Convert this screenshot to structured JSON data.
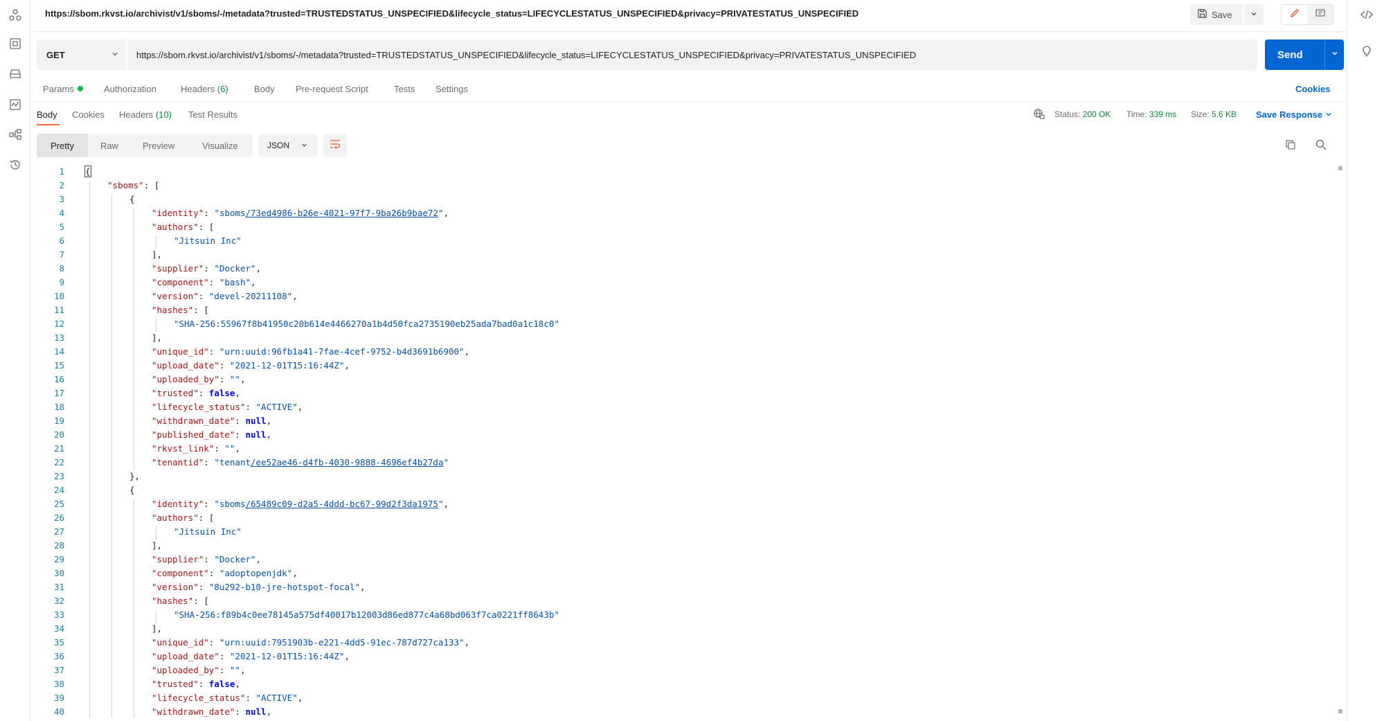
{
  "title_url": "https://sbom.rkvst.io/archivist/v1/sboms/-/metadata?trusted=TRUSTEDSTATUS_UNSPECIFIED&lifecycle_status=LIFECYCLESTATUS_UNSPECIFIED&privacy=PRIVATESTATUS_UNSPECIFIED",
  "save_label": "Save",
  "request": {
    "method": "GET",
    "url": "https://sbom.rkvst.io/archivist/v1/sboms/-/metadata?trusted=TRUSTEDSTATUS_UNSPECIFIED&lifecycle_status=LIFECYCLESTATUS_UNSPECIFIED&privacy=PRIVATESTATUS_UNSPECIFIED",
    "send_label": "Send"
  },
  "request_tabs": {
    "params": "Params",
    "authorization": "Authorization",
    "headers": "Headers",
    "headers_count": "(6)",
    "body": "Body",
    "prerequest": "Pre-request Script",
    "tests": "Tests",
    "settings": "Settings",
    "cookies": "Cookies"
  },
  "response_tabs": {
    "body": "Body",
    "cookies": "Cookies",
    "headers": "Headers",
    "headers_count": "(10)",
    "test_results": "Test Results"
  },
  "response_status": {
    "status_label": "Status:",
    "status_value": "200 OK",
    "time_label": "Time:",
    "time_value": "339 ms",
    "size_label": "Size:",
    "size_value": "5.6 KB",
    "save_response": "Save Response"
  },
  "view_modes": {
    "pretty": "Pretty",
    "raw": "Raw",
    "preview": "Preview",
    "visualize": "Visualize",
    "format": "JSON"
  },
  "icons": {
    "left_rail": [
      "collections-icon",
      "environments-icon",
      "mock-servers-icon",
      "monitors-icon",
      "flows-icon",
      "history-icon"
    ],
    "right_rail": [
      "code-icon",
      "lightbulb-icon"
    ],
    "toolbar": [
      "save-icon",
      "chevron-down-icon",
      "edit-icon",
      "comment-icon",
      "wrap-lines-icon",
      "copy-icon",
      "search-icon",
      "globe-icon"
    ]
  },
  "colors": {
    "send": "#0265d2",
    "status_ok": "#0d8a3a",
    "tab_underline": "#ff6c37",
    "json_key": "#a31515",
    "json_string": "#0451a5",
    "json_literal": "#0000ff",
    "line_number": "#1a7fa3"
  },
  "code_lines": [
    {
      "n": "1",
      "indent": 0,
      "tokens": [
        {
          "t": "p",
          "v": "{"
        }
      ]
    },
    {
      "n": "2",
      "indent": 1,
      "tokens": [
        {
          "t": "k",
          "v": "\"sboms\""
        },
        {
          "t": "p",
          "v": ": ["
        }
      ]
    },
    {
      "n": "3",
      "indent": 2,
      "tokens": [
        {
          "t": "p",
          "v": "{"
        }
      ]
    },
    {
      "n": "4",
      "indent": 3,
      "tokens": [
        {
          "t": "k",
          "v": "\"identity\""
        },
        {
          "t": "p",
          "v": ": "
        },
        {
          "t": "s",
          "v": "\"sboms"
        },
        {
          "t": "lk",
          "v": "/73ed4986-b26e-4021-97f7-9ba26b9bae72"
        },
        {
          "t": "s",
          "v": "\""
        },
        {
          "t": "p",
          "v": ","
        }
      ]
    },
    {
      "n": "5",
      "indent": 3,
      "tokens": [
        {
          "t": "k",
          "v": "\"authors\""
        },
        {
          "t": "p",
          "v": ": ["
        }
      ]
    },
    {
      "n": "6",
      "indent": 4,
      "tokens": [
        {
          "t": "s",
          "v": "\"Jitsuin Inc\""
        }
      ]
    },
    {
      "n": "7",
      "indent": 3,
      "tokens": [
        {
          "t": "p",
          "v": "],"
        }
      ]
    },
    {
      "n": "8",
      "indent": 3,
      "tokens": [
        {
          "t": "k",
          "v": "\"supplier\""
        },
        {
          "t": "p",
          "v": ": "
        },
        {
          "t": "s",
          "v": "\"Docker\""
        },
        {
          "t": "p",
          "v": ","
        }
      ]
    },
    {
      "n": "9",
      "indent": 3,
      "tokens": [
        {
          "t": "k",
          "v": "\"component\""
        },
        {
          "t": "p",
          "v": ": "
        },
        {
          "t": "s",
          "v": "\"bash\""
        },
        {
          "t": "p",
          "v": ","
        }
      ]
    },
    {
      "n": "10",
      "indent": 3,
      "tokens": [
        {
          "t": "k",
          "v": "\"version\""
        },
        {
          "t": "p",
          "v": ": "
        },
        {
          "t": "s",
          "v": "\"devel-20211108\""
        },
        {
          "t": "p",
          "v": ","
        }
      ]
    },
    {
      "n": "11",
      "indent": 3,
      "tokens": [
        {
          "t": "k",
          "v": "\"hashes\""
        },
        {
          "t": "p",
          "v": ": ["
        }
      ]
    },
    {
      "n": "12",
      "indent": 4,
      "tokens": [
        {
          "t": "s",
          "v": "\"SHA-256:55967f8b41950c20b614e4466270a1b4d50fca2735190eb25ada7bad0a1c18c0\""
        }
      ]
    },
    {
      "n": "13",
      "indent": 3,
      "tokens": [
        {
          "t": "p",
          "v": "],"
        }
      ]
    },
    {
      "n": "14",
      "indent": 3,
      "tokens": [
        {
          "t": "k",
          "v": "\"unique_id\""
        },
        {
          "t": "p",
          "v": ": "
        },
        {
          "t": "s",
          "v": "\"urn:uuid:96fb1a41-7fae-4cef-9752-b4d3691b6900\""
        },
        {
          "t": "p",
          "v": ","
        }
      ]
    },
    {
      "n": "15",
      "indent": 3,
      "tokens": [
        {
          "t": "k",
          "v": "\"upload_date\""
        },
        {
          "t": "p",
          "v": ": "
        },
        {
          "t": "s",
          "v": "\"2021-12-01T15:16:44Z\""
        },
        {
          "t": "p",
          "v": ","
        }
      ]
    },
    {
      "n": "16",
      "indent": 3,
      "tokens": [
        {
          "t": "k",
          "v": "\"uploaded_by\""
        },
        {
          "t": "p",
          "v": ": "
        },
        {
          "t": "s",
          "v": "\"\""
        },
        {
          "t": "p",
          "v": ","
        }
      ]
    },
    {
      "n": "17",
      "indent": 3,
      "tokens": [
        {
          "t": "k",
          "v": "\"trusted\""
        },
        {
          "t": "p",
          "v": ": "
        },
        {
          "t": "b",
          "v": "false"
        },
        {
          "t": "p",
          "v": ","
        }
      ]
    },
    {
      "n": "18",
      "indent": 3,
      "tokens": [
        {
          "t": "k",
          "v": "\"lifecycle_status\""
        },
        {
          "t": "p",
          "v": ": "
        },
        {
          "t": "s",
          "v": "\"ACTIVE\""
        },
        {
          "t": "p",
          "v": ","
        }
      ]
    },
    {
      "n": "19",
      "indent": 3,
      "tokens": [
        {
          "t": "k",
          "v": "\"withdrawn_date\""
        },
        {
          "t": "p",
          "v": ": "
        },
        {
          "t": "b",
          "v": "null"
        },
        {
          "t": "p",
          "v": ","
        }
      ]
    },
    {
      "n": "20",
      "indent": 3,
      "tokens": [
        {
          "t": "k",
          "v": "\"published_date\""
        },
        {
          "t": "p",
          "v": ": "
        },
        {
          "t": "b",
          "v": "null"
        },
        {
          "t": "p",
          "v": ","
        }
      ]
    },
    {
      "n": "21",
      "indent": 3,
      "tokens": [
        {
          "t": "k",
          "v": "\"rkvst_link\""
        },
        {
          "t": "p",
          "v": ": "
        },
        {
          "t": "s",
          "v": "\"\""
        },
        {
          "t": "p",
          "v": ","
        }
      ]
    },
    {
      "n": "22",
      "indent": 3,
      "tokens": [
        {
          "t": "k",
          "v": "\"tenantid\""
        },
        {
          "t": "p",
          "v": ": "
        },
        {
          "t": "s",
          "v": "\"tenant"
        },
        {
          "t": "lk",
          "v": "/ee52ae46-d4fb-4030-9888-4696ef4b27da"
        },
        {
          "t": "s",
          "v": "\""
        }
      ]
    },
    {
      "n": "23",
      "indent": 2,
      "tokens": [
        {
          "t": "p",
          "v": "},"
        }
      ]
    },
    {
      "n": "24",
      "indent": 2,
      "tokens": [
        {
          "t": "p",
          "v": "{"
        }
      ]
    },
    {
      "n": "25",
      "indent": 3,
      "tokens": [
        {
          "t": "k",
          "v": "\"identity\""
        },
        {
          "t": "p",
          "v": ": "
        },
        {
          "t": "s",
          "v": "\"sboms"
        },
        {
          "t": "lk",
          "v": "/65489c09-d2a5-4ddd-bc67-99d2f3da1975"
        },
        {
          "t": "s",
          "v": "\""
        },
        {
          "t": "p",
          "v": ","
        }
      ]
    },
    {
      "n": "26",
      "indent": 3,
      "tokens": [
        {
          "t": "k",
          "v": "\"authors\""
        },
        {
          "t": "p",
          "v": ": ["
        }
      ]
    },
    {
      "n": "27",
      "indent": 4,
      "tokens": [
        {
          "t": "s",
          "v": "\"Jitsuin Inc\""
        }
      ]
    },
    {
      "n": "28",
      "indent": 3,
      "tokens": [
        {
          "t": "p",
          "v": "],"
        }
      ]
    },
    {
      "n": "29",
      "indent": 3,
      "tokens": [
        {
          "t": "k",
          "v": "\"supplier\""
        },
        {
          "t": "p",
          "v": ": "
        },
        {
          "t": "s",
          "v": "\"Docker\""
        },
        {
          "t": "p",
          "v": ","
        }
      ]
    },
    {
      "n": "30",
      "indent": 3,
      "tokens": [
        {
          "t": "k",
          "v": "\"component\""
        },
        {
          "t": "p",
          "v": ": "
        },
        {
          "t": "s",
          "v": "\"adoptopenjdk\""
        },
        {
          "t": "p",
          "v": ","
        }
      ]
    },
    {
      "n": "31",
      "indent": 3,
      "tokens": [
        {
          "t": "k",
          "v": "\"version\""
        },
        {
          "t": "p",
          "v": ": "
        },
        {
          "t": "s",
          "v": "\"8u292-b10-jre-hotspot-focal\""
        },
        {
          "t": "p",
          "v": ","
        }
      ]
    },
    {
      "n": "32",
      "indent": 3,
      "tokens": [
        {
          "t": "k",
          "v": "\"hashes\""
        },
        {
          "t": "p",
          "v": ": ["
        }
      ]
    },
    {
      "n": "33",
      "indent": 4,
      "tokens": [
        {
          "t": "s",
          "v": "\"SHA-256:f89b4c0ee78145a575df40017b12003d86ed877c4a68bd063f7ca0221ff8643b\""
        }
      ]
    },
    {
      "n": "34",
      "indent": 3,
      "tokens": [
        {
          "t": "p",
          "v": "],"
        }
      ]
    },
    {
      "n": "35",
      "indent": 3,
      "tokens": [
        {
          "t": "k",
          "v": "\"unique_id\""
        },
        {
          "t": "p",
          "v": ": "
        },
        {
          "t": "s",
          "v": "\"urn:uuid:7951903b-e221-4dd5-91ec-787d727ca133\""
        },
        {
          "t": "p",
          "v": ","
        }
      ]
    },
    {
      "n": "36",
      "indent": 3,
      "tokens": [
        {
          "t": "k",
          "v": "\"upload_date\""
        },
        {
          "t": "p",
          "v": ": "
        },
        {
          "t": "s",
          "v": "\"2021-12-01T15:16:44Z\""
        },
        {
          "t": "p",
          "v": ","
        }
      ]
    },
    {
      "n": "37",
      "indent": 3,
      "tokens": [
        {
          "t": "k",
          "v": "\"uploaded_by\""
        },
        {
          "t": "p",
          "v": ": "
        },
        {
          "t": "s",
          "v": "\"\""
        },
        {
          "t": "p",
          "v": ","
        }
      ]
    },
    {
      "n": "38",
      "indent": 3,
      "tokens": [
        {
          "t": "k",
          "v": "\"trusted\""
        },
        {
          "t": "p",
          "v": ": "
        },
        {
          "t": "b",
          "v": "false"
        },
        {
          "t": "p",
          "v": ","
        }
      ]
    },
    {
      "n": "39",
      "indent": 3,
      "tokens": [
        {
          "t": "k",
          "v": "\"lifecycle_status\""
        },
        {
          "t": "p",
          "v": ": "
        },
        {
          "t": "s",
          "v": "\"ACTIVE\""
        },
        {
          "t": "p",
          "v": ","
        }
      ]
    },
    {
      "n": "40",
      "indent": 3,
      "tokens": [
        {
          "t": "k",
          "v": "\"withdrawn_date\""
        },
        {
          "t": "p",
          "v": ": "
        },
        {
          "t": "b",
          "v": "null"
        },
        {
          "t": "p",
          "v": ","
        }
      ]
    }
  ]
}
